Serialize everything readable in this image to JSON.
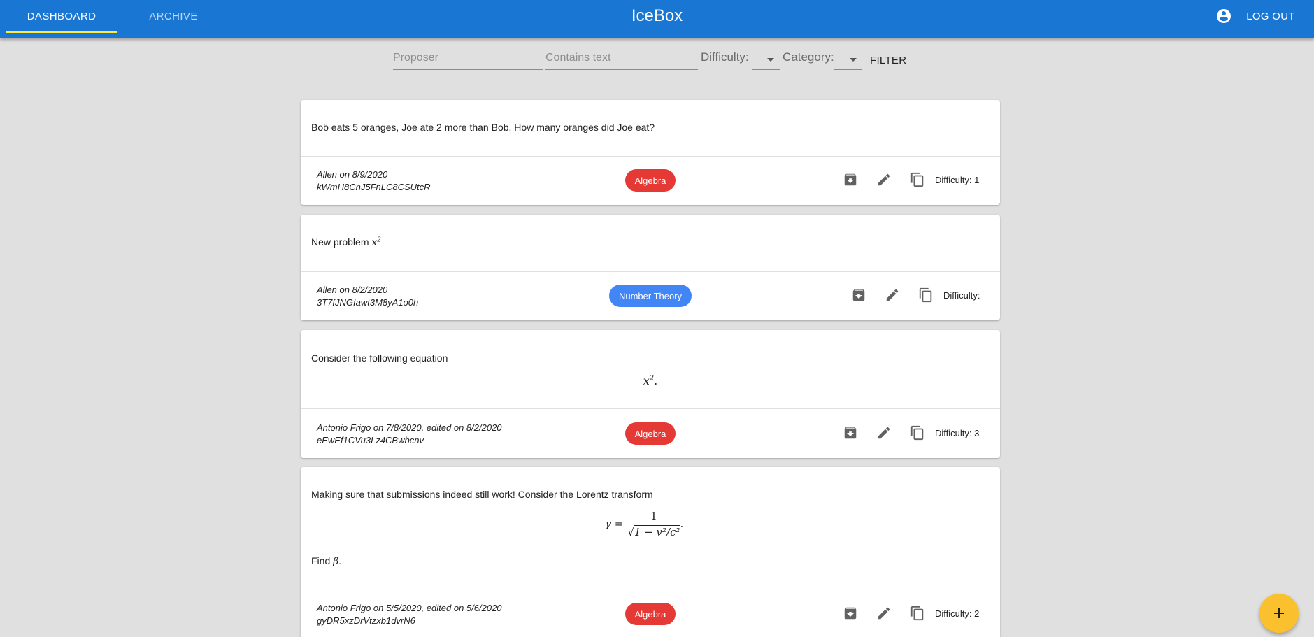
{
  "appbar": {
    "tabs": [
      {
        "label": "DASHBOARD",
        "active": true
      },
      {
        "label": "ARCHIVE",
        "active": false
      }
    ],
    "title": "IceBox",
    "logout_label": "LOG OUT",
    "color": "#1976d2",
    "indicator_color": "#ffeb3b"
  },
  "filter": {
    "proposer_placeholder": "Proposer",
    "text_placeholder": "Contains text",
    "difficulty_label": "Difficulty:",
    "difficulty_value": "",
    "category_label": "Category:",
    "category_value": "",
    "button_label": "FILTER"
  },
  "problems": [
    {
      "text": "Bob eats 5 oranges, Joe ate 2 more than Bob. How many oranges did Joe eat?",
      "author_line": "Allen on 8/9/2020",
      "id": "kWmH8CnJ5FnLC8CSUtcR",
      "category": "Algebra",
      "category_color": "#e53935",
      "difficulty": "Difficulty: 1"
    },
    {
      "text": "New problem",
      "math_base": "x",
      "math_exp": "2",
      "author_line": "Allen on 8/2/2020",
      "id": "3T7fJNGIawt3M8yA1o0h",
      "category": "Number Theory",
      "category_color": "#4285f4",
      "difficulty": "Difficulty:"
    },
    {
      "text": "Consider the following equation",
      "math_base": "x",
      "math_exp": "2",
      "math_end": ".",
      "author_line": "Antonio Frigo on 7/8/2020, edited on 8/2/2020",
      "id": "eEwEf1CVu3Lz4CBwbcnv",
      "category": "Algebra",
      "category_color": "#e53935",
      "difficulty": "Difficulty: 3"
    },
    {
      "text": "Making sure that submissions indeed still work! Consider the Lorentz transform",
      "math_lhs": "γ =",
      "math_num": "1",
      "math_den": "1 − v²/c²",
      "math_end": ".",
      "text2": "Find",
      "text2_math": "β",
      "text2_end": ".",
      "author_line": "Antonio Frigo on 5/5/2020, edited on 5/6/2020",
      "id": "gyDR5xzDrVtzxb1dvrN6",
      "category": "Algebra",
      "category_color": "#e53935",
      "difficulty": "Difficulty: 2"
    }
  ],
  "icons": {
    "account": "account-circle-icon",
    "archive": "archive-icon",
    "edit": "edit-icon",
    "copy": "content-copy-icon",
    "add": "add-icon"
  },
  "fab_color": "#fbc02d"
}
